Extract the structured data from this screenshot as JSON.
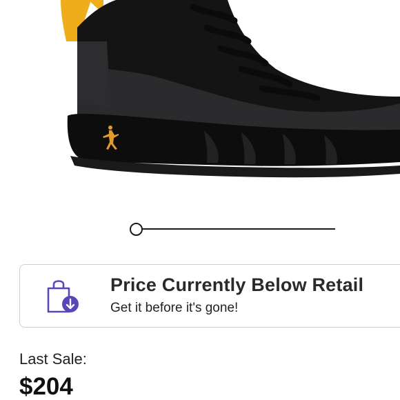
{
  "product": {
    "image_alt": "Black sneaker with yellow accents"
  },
  "viewer": {
    "slider_progress": 0.0
  },
  "retail_card": {
    "title": "Price Currently Below Retail",
    "subtitle": "Get it before it's gone!",
    "icon": "shopping-bag-download-icon",
    "accent_color": "#5b46b8"
  },
  "last_sale": {
    "label": "Last Sale:",
    "value": "$204"
  }
}
